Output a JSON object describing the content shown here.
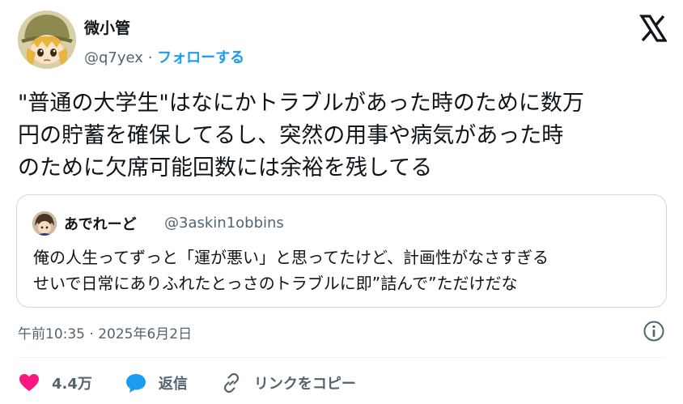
{
  "author": {
    "name": "微小管",
    "handle": "@q7yex",
    "separator": "·",
    "follow_label": "フォローする"
  },
  "tweet": {
    "text_lines": [
      "\"普通の大学生\"はなにかトラブルがあった時のために数万",
      "円の貯蓄を確保してるし、突然の用事や病気があった時",
      "のために欠席可能回数には余裕を残してる"
    ],
    "timestamp": "午前10:35 · 2025年6月2日"
  },
  "quoted": {
    "name": "あでれーど",
    "handle": "@3askin1obbins",
    "text_lines": [
      "俺の人生ってずっと「運が悪い」と思ってたけど、計画性がなさすぎる",
      "せいで日常にありふれたとっさのトラブルに即”詰んで”ただけだな"
    ]
  },
  "actions": {
    "like_count": "4.4万",
    "reply_label": "返信",
    "copy_link_label": "リンクをコピー"
  },
  "icons": {
    "logo": "x-logo-icon",
    "info": "info-icon",
    "like": "heart-icon",
    "reply": "speech-bubble-icon",
    "link": "link-icon"
  },
  "colors": {
    "accent": "#1d9bf0",
    "like": "#f91880",
    "muted": "#536471",
    "text": "#0f1419",
    "border": "#cfd9de"
  }
}
